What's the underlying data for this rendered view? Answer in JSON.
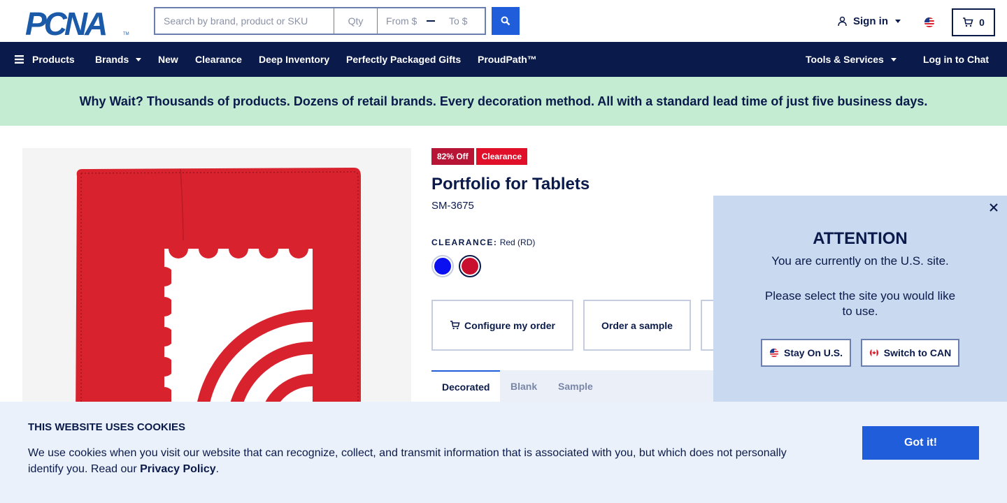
{
  "header": {
    "logo_text": "PCNA",
    "logo_tm": "TM",
    "search_placeholder": "Search by brand, product or SKU",
    "qty_placeholder": "Qty",
    "price_from_placeholder": "From $",
    "price_to_placeholder": "To $",
    "signin_label": "Sign in",
    "cart_count": "0"
  },
  "nav": {
    "products": "Products",
    "brands": "Brands",
    "new": "New",
    "clearance": "Clearance",
    "deep_inventory": "Deep Inventory",
    "gifts": "Perfectly Packaged Gifts",
    "proudpath": "ProudPath™",
    "tools": "Tools & Services",
    "chat": "Log in to Chat"
  },
  "promo": {
    "text": "Why Wait? Thousands of products. Dozens of retail brands. Every decoration method. All with a standard lead time of just five business days."
  },
  "product": {
    "badge_off": "82% Off",
    "badge_clearance": "Clearance",
    "title": "Portfolio for Tablets",
    "sku": "SM-3675",
    "color_label": "CLEARANCE:",
    "color_value": "Red (RD)",
    "swatches": [
      {
        "name": "Blue",
        "color": "#0a10f0",
        "selected": false
      },
      {
        "name": "Red",
        "color": "#c8102e",
        "selected": true
      }
    ],
    "actions": {
      "configure": "Configure my order",
      "sample": "Order a sample"
    },
    "tabs": [
      "Decorated",
      "Blank",
      "Sample"
    ],
    "active_tab": "Decorated",
    "image_color": "#d8232f"
  },
  "site_modal": {
    "title": "ATTENTION",
    "line1": "You are currently on the U.S. site.",
    "line2": "Please select the site you would like to use.",
    "stay_label": "Stay On U.S.",
    "switch_label": "Switch to CAN"
  },
  "cookie": {
    "title": "THIS WEBSITE USES COOKIES",
    "text_before": "We use cookies when you visit our website that can recognize, collect, and transmit information that is associated with you, but which does not personally identify you. Read our ",
    "link": "Privacy Policy",
    "text_after": ".",
    "button": "Got it!"
  },
  "colors": {
    "navy": "#0a1a4a",
    "accent_blue": "#1f5ddb",
    "promo_bg": "#c3ecd2",
    "badge_off": "#b81436",
    "badge_clearance": "#e0102a"
  }
}
